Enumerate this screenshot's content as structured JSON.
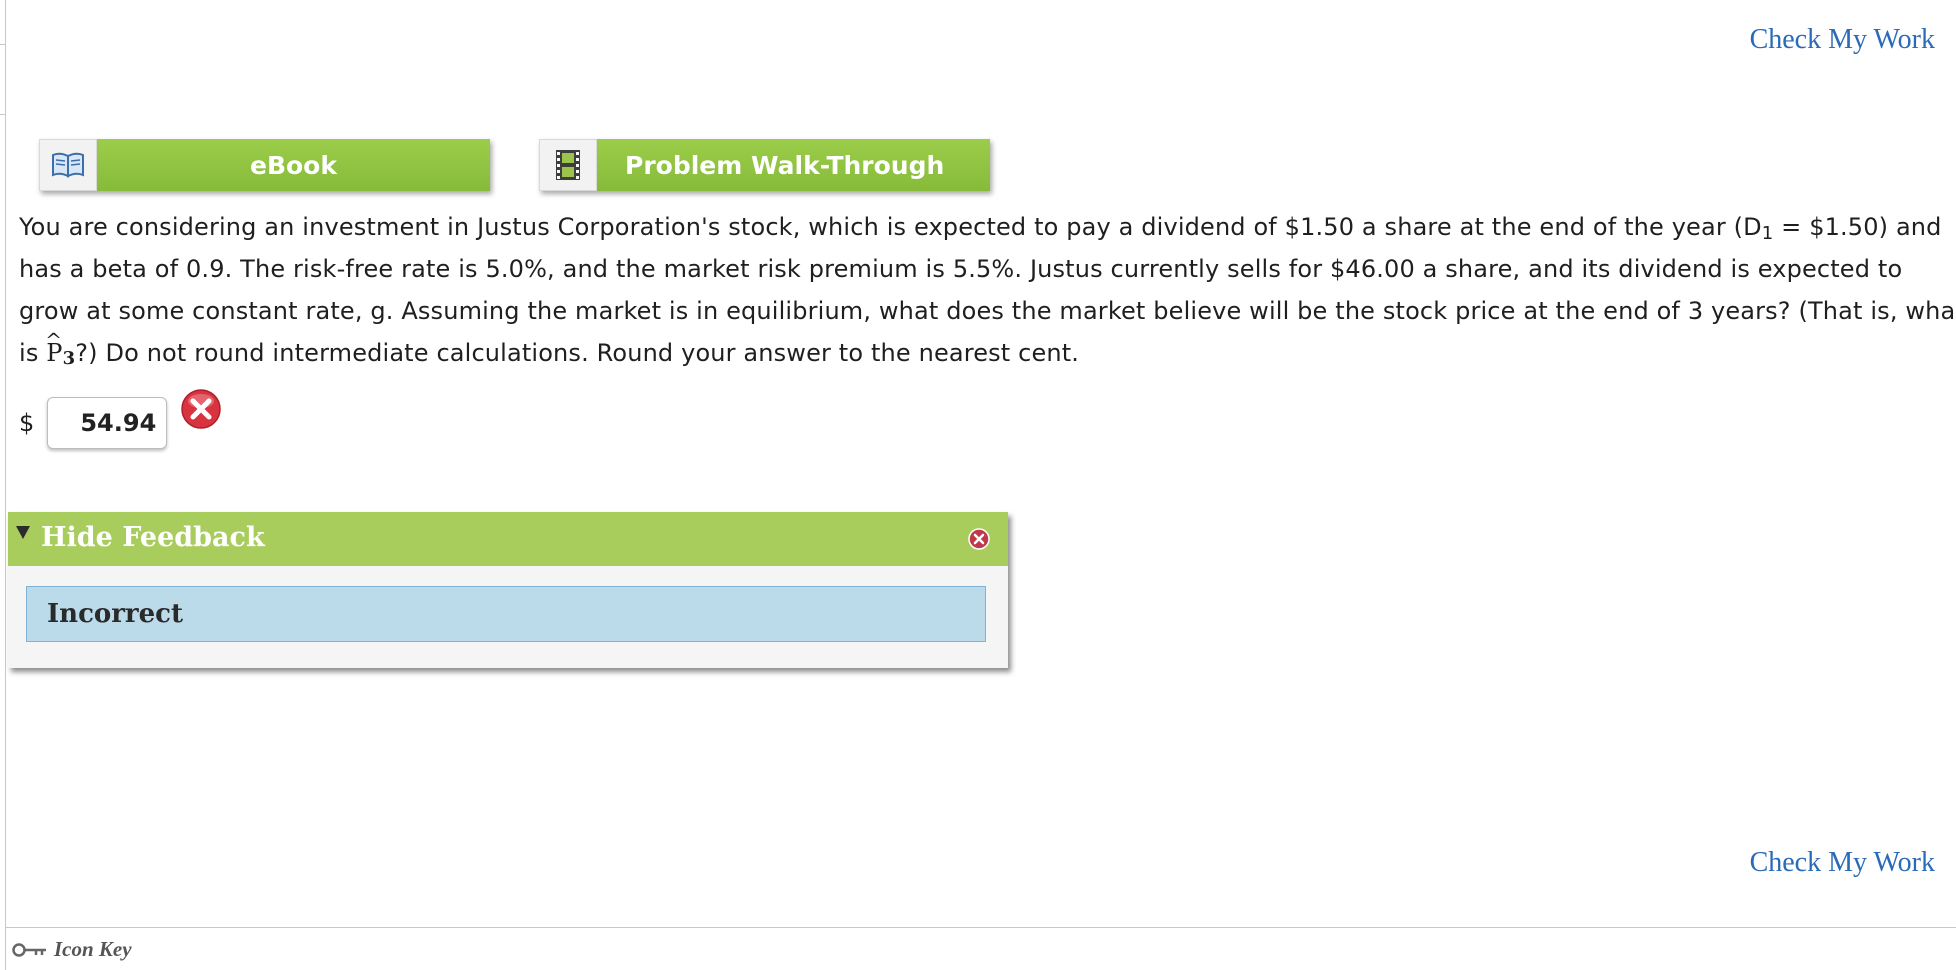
{
  "header": {
    "check_my_work": "Check My Work"
  },
  "resources": {
    "ebook": {
      "label": "eBook",
      "icon": "book-icon"
    },
    "walkthrough": {
      "label": "Problem Walk-Through",
      "icon": "film-icon"
    }
  },
  "question": {
    "line1_a": "You are considering an investment in Justus Corporation's stock, which is expected to pay a dividend of $1.50 a share at the end of the year (D",
    "line1_sub": "1",
    "line1_b": " = $1.50) and",
    "line2": "has a beta of 0.9. The risk-free rate is 5.0%, and the market risk premium is 5.5%. Justus currently sells for $46.00 a share, and its dividend is expected to",
    "line3": "grow at some constant rate, g. Assuming the market is in equilibrium, what does the market believe will be the stock price at the end of 3 years? (That is, what",
    "line4_a": "is ",
    "p_symbol": "P",
    "p_hat": "^",
    "p_sub": "3",
    "line4_b": "?) Do not round intermediate calculations. Round your answer to the nearest cent."
  },
  "answer": {
    "currency": "$",
    "value": "54.94",
    "status_icon": "incorrect-icon"
  },
  "feedback": {
    "toggle_label": "Hide Feedback",
    "status": "Incorrect"
  },
  "footer": {
    "check_my_work": "Check My Work",
    "icon_key": "Icon Key"
  },
  "colors": {
    "accent_green": "#8fc341",
    "link_blue": "#2a6bb7",
    "feedback_blue": "#bcdbea",
    "error_red": "#d9333f"
  }
}
